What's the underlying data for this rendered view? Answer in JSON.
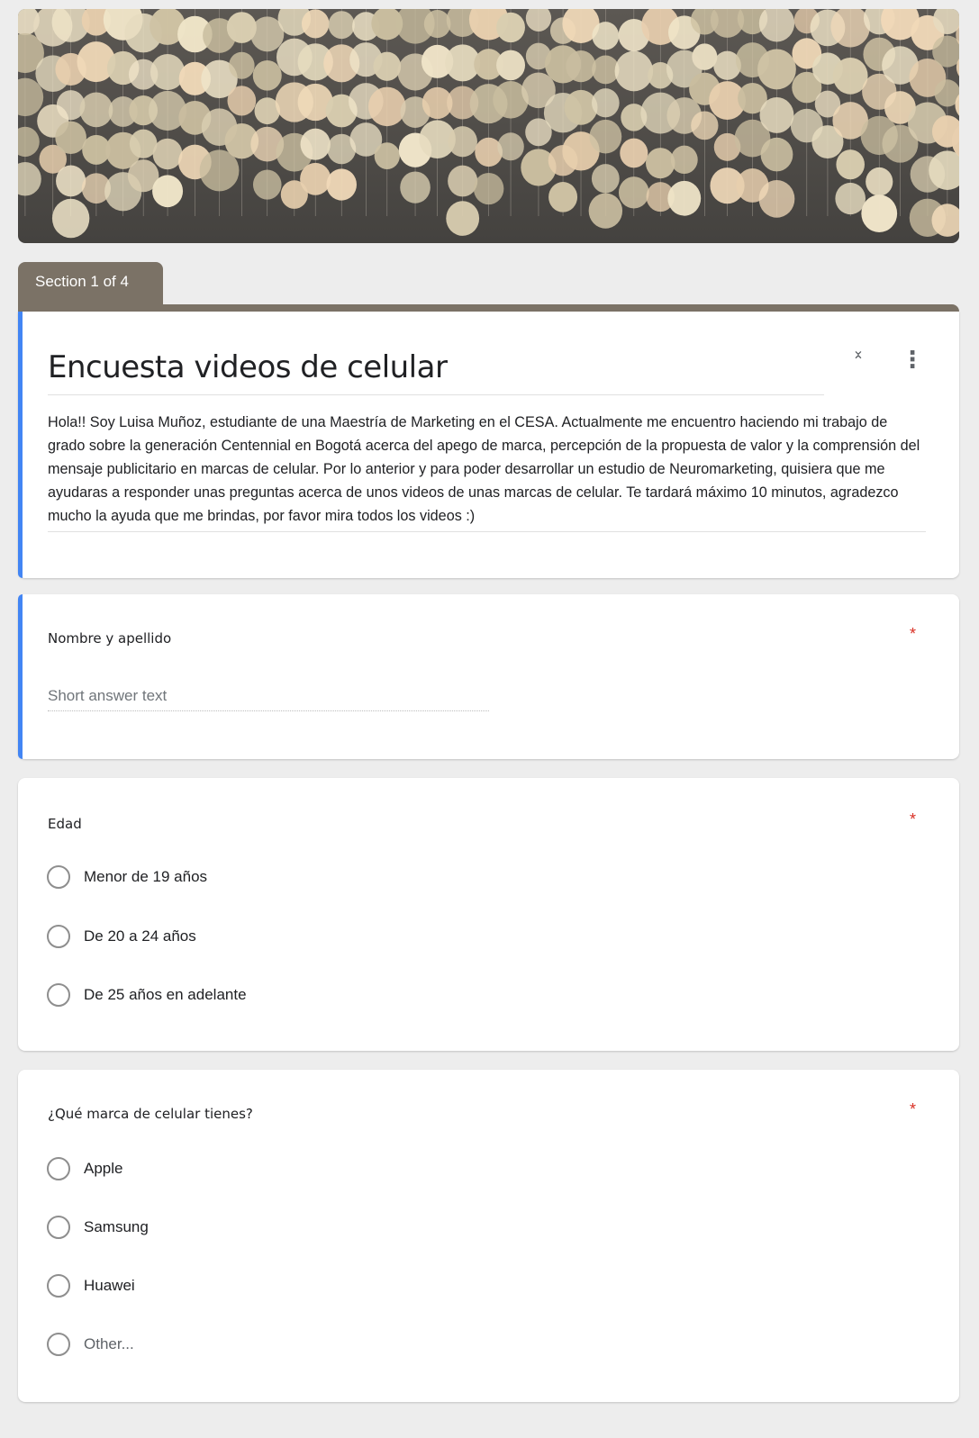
{
  "section_label": "Section 1 of 4",
  "form": {
    "title": "Encuesta videos de celular",
    "description": "Hola!! Soy Luisa Muñoz, estudiante de una Maestría de Marketing en el CESA. Actualmente me encuentro haciendo mi trabajo de grado sobre la generación Centennial en Bogotá acerca del apego de marca, percepción de la propuesta de valor y la comprensión del mensaje publicitario en marcas de celular. Por lo anterior y para poder desarrollar un estudio de Neuromarketing, quisiera que me ayudaras a responder unas preguntas acerca de unos videos de unas marcas de celular. Te tardará máximo 10 minutos, agradezco mucho la ayuda que me brindas, por favor mira todos los videos :)"
  },
  "icons": {
    "collapse": "collapse-icon",
    "more": "more-vert-icon"
  },
  "questions": [
    {
      "title": "Nombre y apellido",
      "required_mark": "*",
      "type": "short_answer",
      "placeholder": "Short answer text"
    },
    {
      "title": "Edad",
      "required_mark": "*",
      "type": "multiple_choice",
      "options": [
        "Menor de 19 años",
        "De 20 a 24 años",
        "De 25 años en adelante"
      ]
    },
    {
      "title": "¿Qué marca de celular tienes?",
      "required_mark": "*",
      "type": "multiple_choice",
      "options": [
        "Apple",
        "Samsung",
        "Huawei",
        "Other..."
      ]
    }
  ],
  "colors": {
    "section_header": "#7b7266",
    "accent": "#4285f4",
    "required": "#d93025",
    "background": "#ededed"
  }
}
